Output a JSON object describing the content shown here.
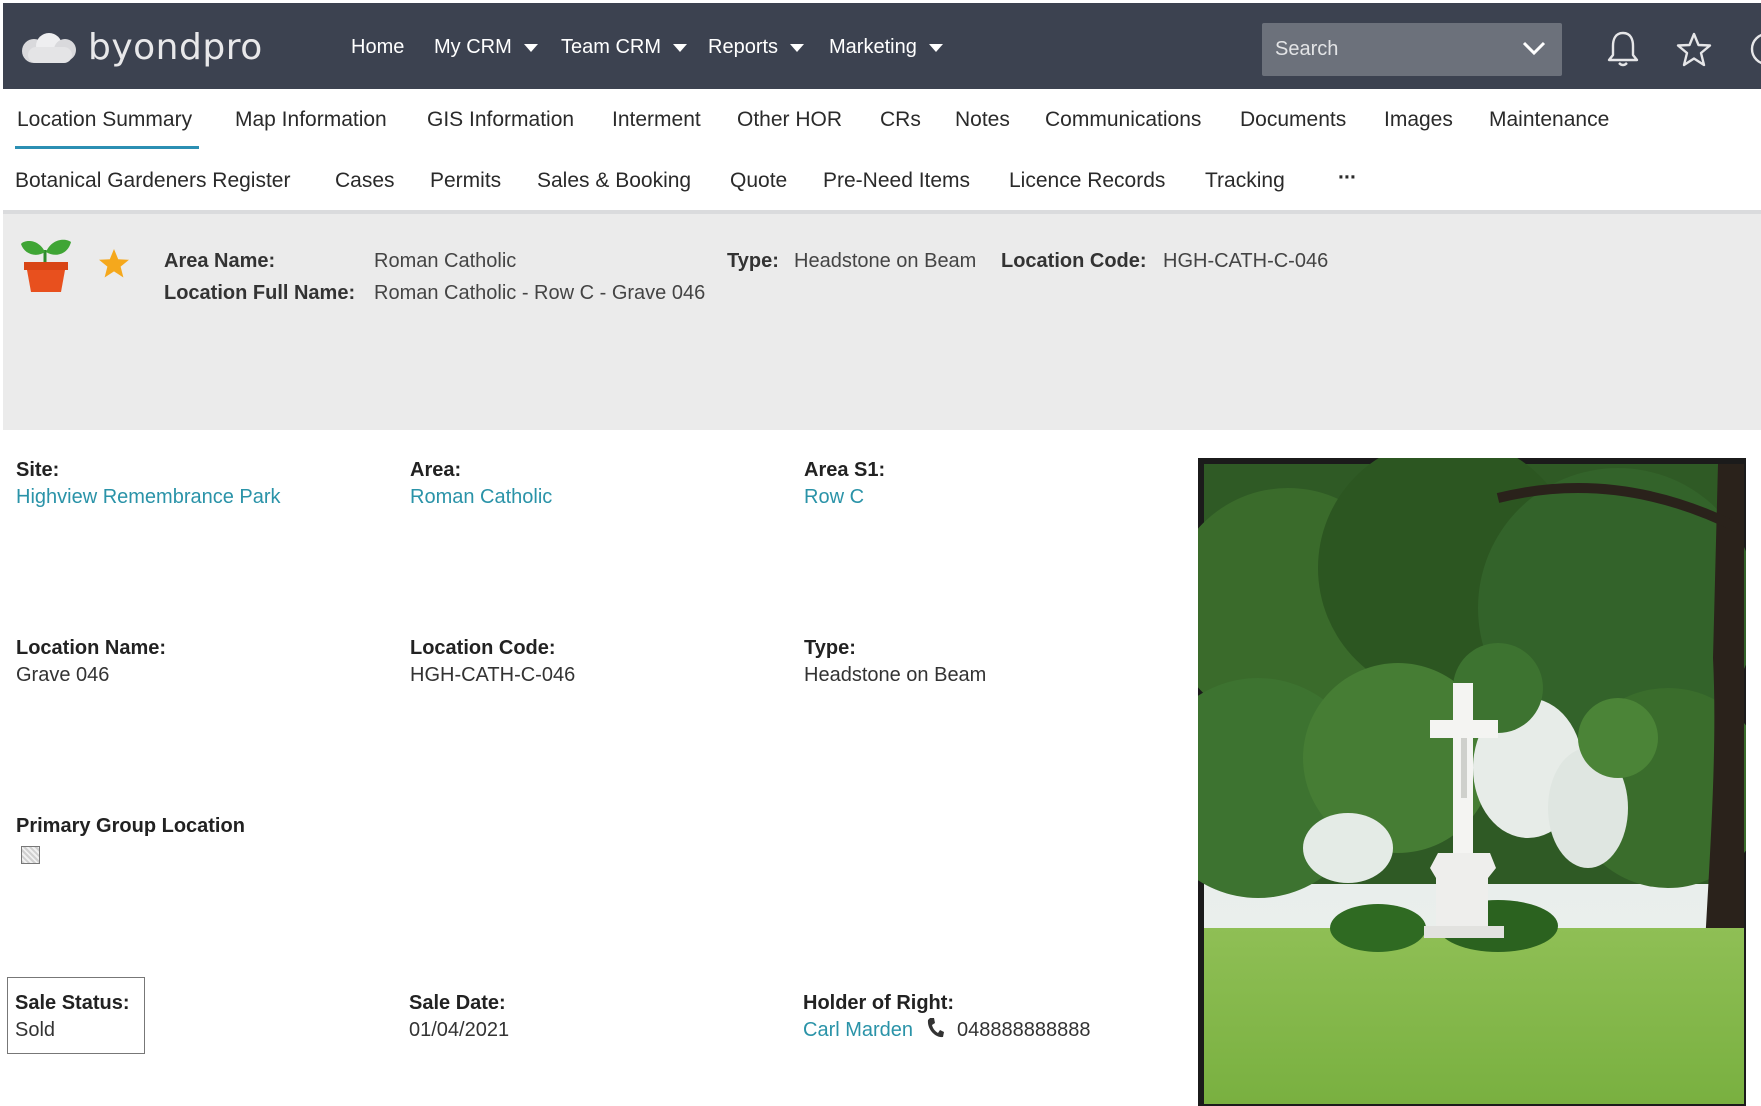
{
  "brand": {
    "name": "byondpro"
  },
  "topnav": {
    "items": [
      {
        "label": "Home",
        "has_dropdown": false
      },
      {
        "label": "My CRM",
        "has_dropdown": true
      },
      {
        "label": "Team CRM",
        "has_dropdown": true
      },
      {
        "label": "Reports",
        "has_dropdown": true
      },
      {
        "label": "Marketing",
        "has_dropdown": true
      }
    ],
    "search_placeholder": "Search",
    "icons": [
      "bell-icon",
      "star-outline-icon",
      "settings-icon"
    ]
  },
  "tabs": {
    "row1": [
      "Location Summary",
      "Map Information",
      "GIS Information",
      "Interment",
      "Other HOR",
      "CRs",
      "Notes",
      "Communications",
      "Documents",
      "Images",
      "Maintenance"
    ],
    "row2": [
      "Botanical Gardeners Register",
      "Cases",
      "Permits",
      "Sales & Booking",
      "Quote",
      "Pre-Need Items",
      "Licence Records",
      "Tracking"
    ],
    "more_label": "···",
    "active": "Location Summary"
  },
  "summary": {
    "area_name_label": "Area Name:",
    "area_name": "Roman Catholic",
    "full_name_label": "Location Full Name:",
    "full_name": "Roman Catholic - Row C - Grave 046",
    "type_label": "Type:",
    "type": "Headstone on Beam",
    "code_label": "Location Code:",
    "code": "HGH-CATH-C-046"
  },
  "fields": {
    "site_label": "Site:",
    "site": "Highview Remembrance Park",
    "area_label": "Area:",
    "area": "Roman Catholic",
    "area_s1_label": "Area S1:",
    "area_s1": "Row C",
    "location_name_label": "Location Name:",
    "location_name": "Grave 046",
    "location_code_label": "Location Code:",
    "location_code": "HGH-CATH-C-046",
    "type_label": "Type:",
    "type": "Headstone on Beam",
    "primary_group_label": "Primary Group Location",
    "primary_group_checked": false,
    "sale_status_label": "Sale Status:",
    "sale_status": "Sold",
    "sale_date_label": "Sale Date:",
    "sale_date": "01/04/2021",
    "holder_label": "Holder of Right:",
    "holder_name": "Carl Marden",
    "holder_phone": "048888888888"
  },
  "colors": {
    "topbar": "#3c4250",
    "accent": "#2b8fb3",
    "link": "#2a93a8",
    "summary_band": "#ebebeb",
    "favorite_star": "#f5a81c",
    "plant_pot": "#e8501e",
    "plant_leaves": "#3fa535"
  }
}
